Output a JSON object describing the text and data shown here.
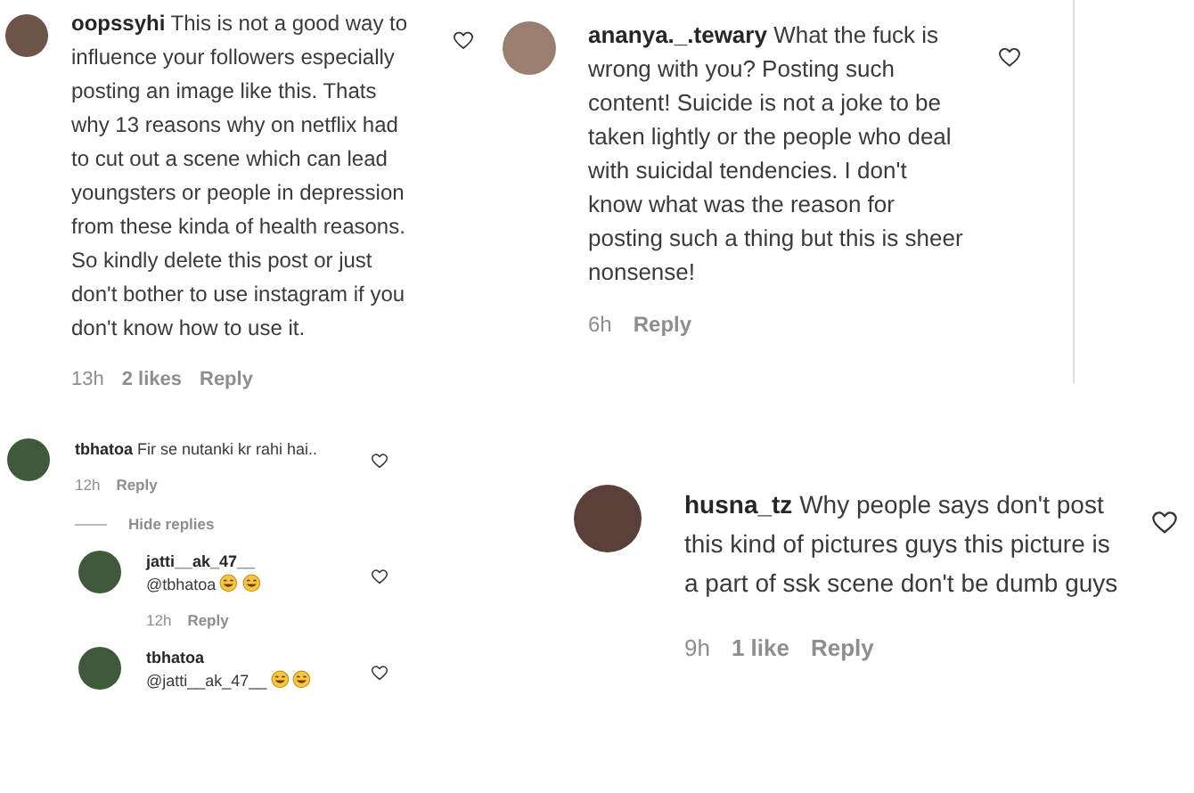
{
  "panels": [
    {
      "kind": "standard",
      "comments": [
        {
          "username": "oopssyhi",
          "text": "This is not a good way to influence your followers especially posting an image like this. Thats why 13 reasons why on netflix had to cut out a scene which can lead youngsters or people in depression from these kinda of health reasons. So kindly delete this post or just don't bother to use instagram if you don't know how to use it.",
          "time": "13h",
          "likes": "2 likes",
          "reply": "Reply"
        }
      ]
    },
    {
      "kind": "wide",
      "comments": [
        {
          "username": "ananya._.tewary",
          "text": "What the fuck is wrong with you? Posting such content! Suicide is not a joke to be taken lightly or the people who deal with suicidal tendencies. I don't know what was the reason for posting such a thing but this is sheer nonsense!",
          "time": "6h",
          "reply": "Reply"
        }
      ]
    },
    {
      "kind": "compact",
      "comments": [
        {
          "username": "tbhatoa",
          "text": "Fir se nutanki kr rahi hai..",
          "time": "12h",
          "reply": "Reply",
          "replies_toggle": "Hide replies",
          "replies": [
            {
              "username": "jatti__ak_47__",
              "text": "@tbhatoa",
              "emojis": [
                {
                  "kind": "grin"
                },
                {
                  "kind": "grin"
                }
              ],
              "time": "12h",
              "reply": "Reply"
            },
            {
              "username": "tbhatoa",
              "text": "@jatti__ak_47__",
              "emojis": [
                {
                  "kind": "grin"
                },
                {
                  "kind": "grin"
                }
              ]
            }
          ]
        }
      ]
    },
    {
      "kind": "large",
      "comments": [
        {
          "username": "husna_tz",
          "text": "Why people says don't post this kind of pictures guys this picture is a part of ssk scene don't be dumb guys",
          "time": "9h",
          "likes": "1 like",
          "reply": "Reply"
        }
      ]
    }
  ]
}
